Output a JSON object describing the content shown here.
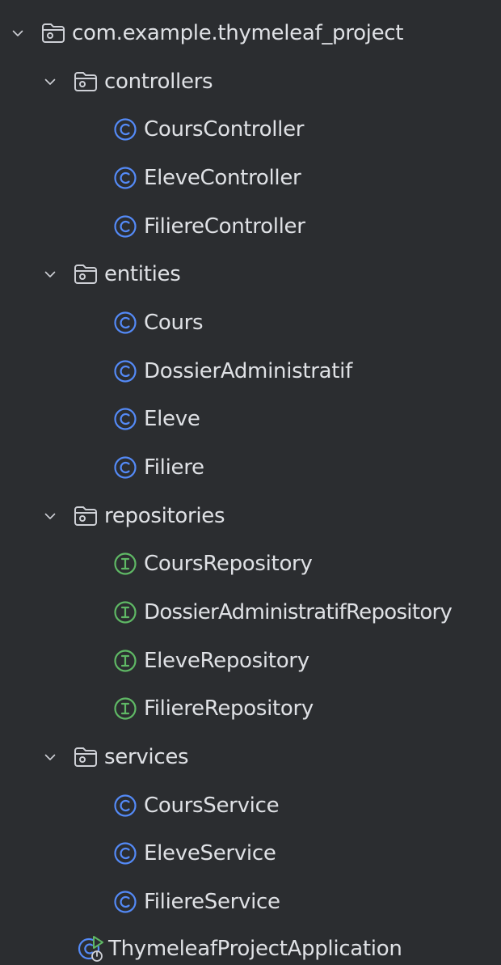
{
  "tree": {
    "root": {
      "label": "com.example.thymeleaf_project",
      "icon": "package-icon",
      "expanded": true
    },
    "packages": [
      {
        "label": "controllers",
        "icon": "package-icon",
        "expanded": true,
        "children": [
          {
            "label": "CoursController",
            "kind": "class"
          },
          {
            "label": "EleveController",
            "kind": "class"
          },
          {
            "label": "FiliereController",
            "kind": "class"
          }
        ]
      },
      {
        "label": "entities",
        "icon": "package-icon",
        "expanded": true,
        "children": [
          {
            "label": "Cours",
            "kind": "class"
          },
          {
            "label": "DossierAdministratif",
            "kind": "class"
          },
          {
            "label": "Eleve",
            "kind": "class"
          },
          {
            "label": "Filiere",
            "kind": "class"
          }
        ]
      },
      {
        "label": "repositories",
        "icon": "package-icon",
        "expanded": true,
        "children": [
          {
            "label": "CoursRepository",
            "kind": "interface"
          },
          {
            "label": "DossierAdministratifRepository",
            "kind": "interface"
          },
          {
            "label": "EleveRepository",
            "kind": "interface"
          },
          {
            "label": "FiliereRepository",
            "kind": "interface"
          }
        ]
      },
      {
        "label": "services",
        "icon": "package-icon",
        "expanded": true,
        "children": [
          {
            "label": "CoursService",
            "kind": "class"
          },
          {
            "label": "EleveService",
            "kind": "class"
          },
          {
            "label": "FiliereService",
            "kind": "class"
          }
        ]
      }
    ],
    "app_class": {
      "label": "ThymeleafProjectApplication",
      "kind": "spring-boot-application"
    }
  },
  "colors": {
    "background": "#2b2d30",
    "text": "#dfe1e5",
    "class_icon": "#548af7",
    "interface_icon": "#5fb865",
    "folder_icon": "#ced0d6",
    "chevron": "#ced0d6",
    "run_badge": "#5fb865"
  },
  "icons": {
    "chevron": "chevron-down-icon",
    "class": "class-icon",
    "interface": "interface-icon",
    "application": "spring-boot-run-icon"
  }
}
